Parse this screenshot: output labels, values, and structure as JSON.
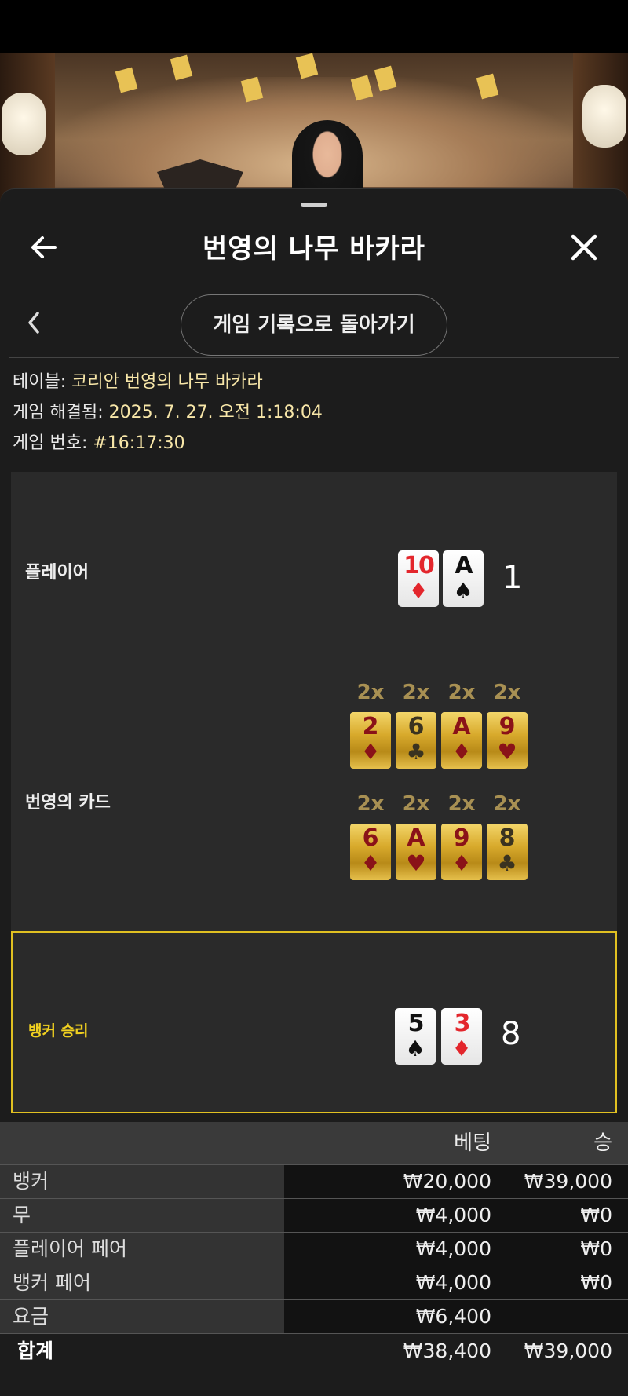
{
  "header": {
    "title": "번영의 나무 바카라"
  },
  "subnav": {
    "return_label": "게임 기록으로 돌아가기"
  },
  "info": {
    "table_label": "테이블: ",
    "table_value": "코리안 번영의 나무 바카라",
    "resolved_label": "게임 해결됨: ",
    "resolved_value": "2025. 7. 27. 오전 1:18:04",
    "number_label": "게임 번호: ",
    "number_value": "#16:17:30"
  },
  "player": {
    "label": "플레이어",
    "cards": [
      {
        "rank": "10",
        "suit": "♦",
        "color": "red"
      },
      {
        "rank": "A",
        "suit": "♠",
        "color": "black"
      }
    ],
    "total": "1"
  },
  "prosperity": {
    "label": "번영의 카드",
    "rows": [
      [
        {
          "mult": "2x",
          "rank": "2",
          "suit": "♦",
          "color": "red"
        },
        {
          "mult": "2x",
          "rank": "6",
          "suit": "♣",
          "color": "black"
        },
        {
          "mult": "2x",
          "rank": "A",
          "suit": "♦",
          "color": "red"
        },
        {
          "mult": "2x",
          "rank": "9",
          "suit": "♥",
          "color": "red"
        }
      ],
      [
        {
          "mult": "2x",
          "rank": "6",
          "suit": "♦",
          "color": "red"
        },
        {
          "mult": "2x",
          "rank": "A",
          "suit": "♥",
          "color": "red"
        },
        {
          "mult": "2x",
          "rank": "9",
          "suit": "♦",
          "color": "red"
        },
        {
          "mult": "2x",
          "rank": "8",
          "suit": "♣",
          "color": "black"
        }
      ]
    ]
  },
  "banker": {
    "label": "뱅커 승리",
    "cards": [
      {
        "rank": "5",
        "suit": "♠",
        "color": "black"
      },
      {
        "rank": "3",
        "suit": "♦",
        "color": "red"
      }
    ],
    "total": "8"
  },
  "bets": {
    "col_bet": "베팅",
    "col_win": "승",
    "rows": [
      {
        "name": "뱅커",
        "bet": "₩20,000",
        "win": "₩39,000"
      },
      {
        "name": "무",
        "bet": "₩4,000",
        "win": "₩0"
      },
      {
        "name": "플레이어 페어",
        "bet": "₩4,000",
        "win": "₩0"
      },
      {
        "name": "뱅커 페어",
        "bet": "₩4,000",
        "win": "₩0"
      },
      {
        "name": "요금",
        "bet": "₩6,400",
        "win": ""
      }
    ],
    "total": {
      "name": "합계",
      "bet": "₩38,400",
      "win": "₩39,000"
    }
  },
  "colors": {
    "accent_gold": "#e0c021",
    "panel_bg": "#1c1c1c",
    "info_value": "#f7e6a8"
  },
  "icons": {
    "back": "arrow-left-icon",
    "close": "close-icon",
    "chevron": "chevron-left-icon"
  }
}
